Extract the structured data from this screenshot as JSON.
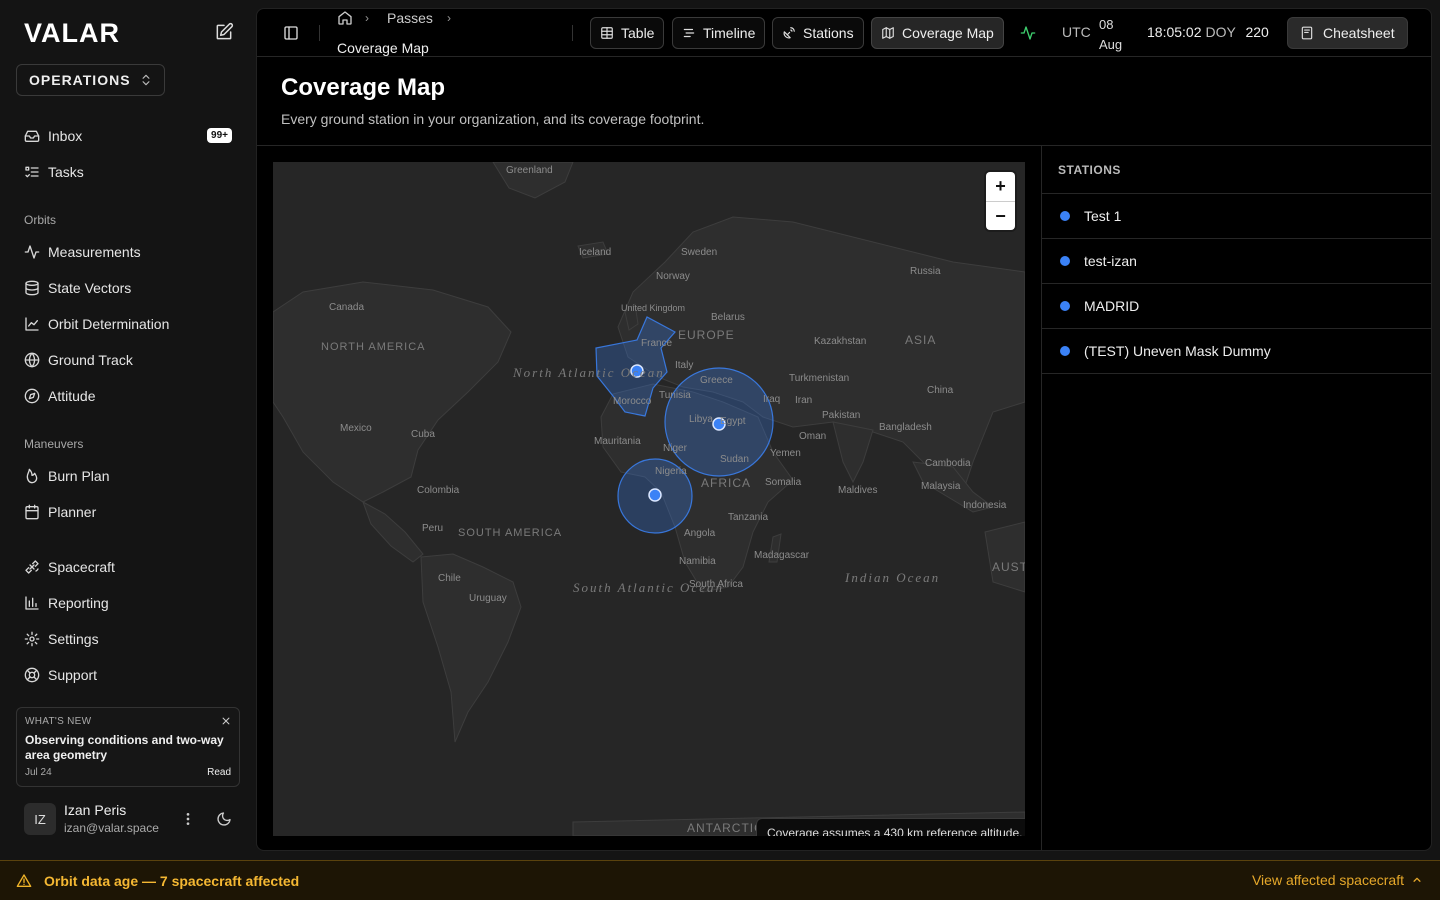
{
  "sidebar": {
    "logo": "VALAR",
    "org_switch": "OPERATIONS",
    "nav_top": [
      {
        "label": "Inbox",
        "badge": "99+",
        "icon": "inbox-icon"
      },
      {
        "label": "Tasks",
        "icon": "tasks-icon"
      }
    ],
    "groups": {
      "orbits": "Orbits",
      "maneuvers": "Maneuvers"
    },
    "orbits_items": [
      {
        "label": "Measurements",
        "icon": "activity-icon"
      },
      {
        "label": "State Vectors",
        "icon": "database-icon"
      },
      {
        "label": "Orbit Determination",
        "icon": "chart-line-icon"
      },
      {
        "label": "Ground Track",
        "icon": "globe-icon"
      },
      {
        "label": "Attitude",
        "icon": "compass-icon"
      }
    ],
    "maneuver_items": [
      {
        "label": "Burn Plan",
        "icon": "flame-icon"
      },
      {
        "label": "Planner",
        "icon": "calendar-icon"
      }
    ],
    "bottom_items": [
      {
        "label": "Spacecraft",
        "icon": "satellite-icon"
      },
      {
        "label": "Reporting",
        "icon": "bar-chart-icon"
      },
      {
        "label": "Settings",
        "icon": "gear-icon"
      },
      {
        "label": "Support",
        "icon": "lifebuoy-icon"
      }
    ],
    "whats_new": {
      "heading": "WHAT'S NEW",
      "title": "Observing conditions and two-way area geometry",
      "date": "Jul 24",
      "read_label": "Read"
    },
    "user": {
      "initials": "IZ",
      "name": "Izan Peris",
      "email": "izan@valar.space"
    }
  },
  "topbar": {
    "breadcrumb_parent": "Passes",
    "breadcrumb_current": "Coverage Map",
    "views": [
      {
        "label": "Table",
        "icon": "table-icon"
      },
      {
        "label": "Timeline",
        "icon": "timeline-icon"
      },
      {
        "label": "Stations",
        "icon": "antenna-icon"
      },
      {
        "label": "Coverage Map",
        "icon": "map-icon"
      }
    ],
    "active_view": "Coverage Map",
    "utc_label": "UTC",
    "date_day": "08",
    "date_month": "Aug",
    "time": "18:05:02",
    "doy_label": "DOY",
    "doy_value": "220",
    "cheatsheet_label": "Cheatsheet"
  },
  "page": {
    "title": "Coverage Map",
    "subtitle": "Every ground station in your organization, and its coverage footprint."
  },
  "map": {
    "zoom_in": "+",
    "zoom_out": "−",
    "note": "Coverage assumes a 430 km reference altitude.",
    "labels": {
      "greenland": "Greenland",
      "iceland": "Iceland",
      "sweden": "Sweden",
      "norway": "Norway",
      "russia": "Russia",
      "canada": "Canada",
      "uk": "United Kingdom",
      "belarus": "Belarus",
      "europe": "EUROPE",
      "kazakhstan": "Kazakhstan",
      "asia": "ASIA",
      "north_america": "NORTH AMERICA",
      "north_atlantic": "North Atlantic Ocean",
      "france": "France",
      "italy": "Italy",
      "greece": "Greece",
      "turkmenistan": "Turkmenistan",
      "tunisia": "Tunisia",
      "morocco": "Morocco",
      "iraq": "Iraq",
      "iran": "Iran",
      "china": "China",
      "libya": "Libya",
      "egypt": "Egypt",
      "pakistan": "Pakistan",
      "mexico": "Mexico",
      "cuba": "Cuba",
      "mauritania": "Mauritania",
      "niger": "Niger",
      "oman": "Oman",
      "bangladesh": "Bangladesh",
      "sudan": "Sudan",
      "yemen": "Yemen",
      "cambodia": "Cambodia",
      "nigeria": "Nigeria",
      "colombia": "Colombia",
      "africa": "AFRICA",
      "somalia": "Somalia",
      "maldives": "Maldives",
      "malaysia": "Malaysia",
      "indonesia": "Indonesia",
      "peru": "Peru",
      "south_america": "SOUTH AMERICA",
      "tanzania": "Tanzania",
      "angola": "Angola",
      "madagascar": "Madagascar",
      "south_atlantic": "South Atlantic Ocean",
      "indian": "Indian Ocean",
      "namibia": "Namibia",
      "aust": "AUST",
      "chile": "Chile",
      "south_africa": "South Africa",
      "uruguay": "Uruguay",
      "antarctica": "ANTARCTIC"
    },
    "footprint_color": "#3b82f6"
  },
  "stations": {
    "heading": "STATIONS",
    "items": [
      "Test 1",
      "test-izan",
      "MADRID",
      "(TEST) Uneven Mask Dummy"
    ],
    "dot_color": "#3b82f6"
  },
  "banner": {
    "text": "Orbit data age — 7 spacecraft affected",
    "link": "View affected spacecraft"
  }
}
